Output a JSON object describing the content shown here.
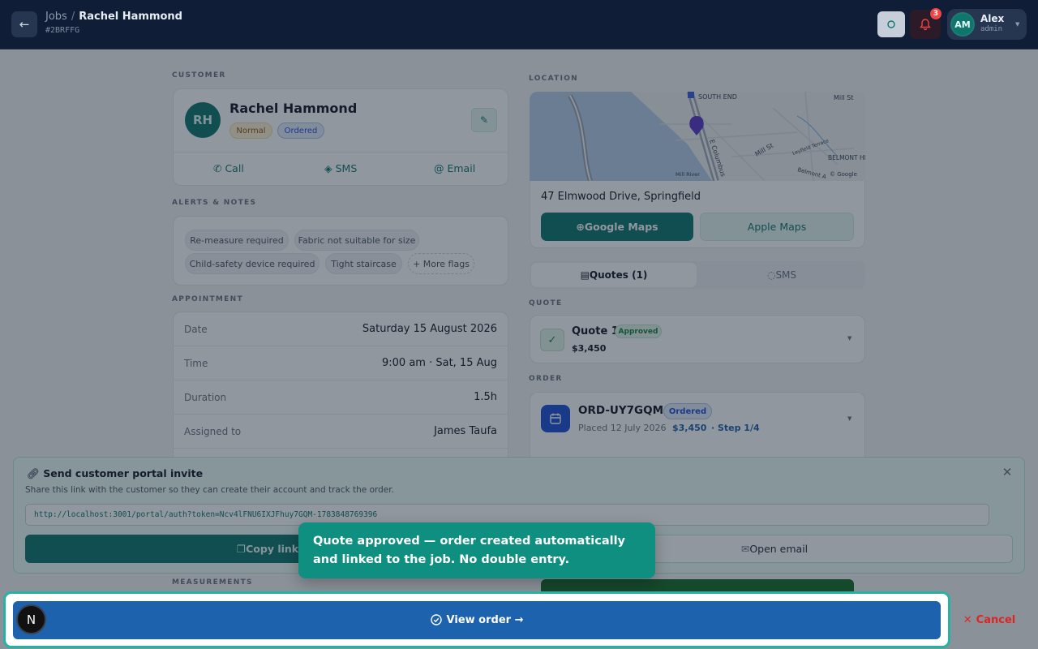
{
  "header": {
    "back_label": "←",
    "breadcrumb_root": "Jobs",
    "breadcrumb_sep": "/",
    "breadcrumb_current": "Rachel Hammond",
    "job_id": "#2BRFFG",
    "notification_count": "3",
    "user": {
      "initials": "AM",
      "name": "Alex",
      "role": "admin"
    }
  },
  "customer": {
    "section": "CUSTOMER",
    "initials": "RH",
    "name": "Rachel Hammond",
    "tags": [
      "Normal",
      "Ordered"
    ],
    "actions": {
      "call": "Call",
      "sms": "SMS",
      "email": "Email"
    }
  },
  "alerts": {
    "section": "ALERTS & NOTES",
    "chips": [
      "Re-measure required",
      "Fabric not suitable for size",
      "Child-safety device required",
      "Tight staircase"
    ],
    "more": "+ More flags"
  },
  "appointment": {
    "section": "APPOINTMENT",
    "rows": [
      {
        "label": "Date",
        "value": "Saturday 15 August 2026"
      },
      {
        "label": "Time",
        "value": "9:00 am · Sat, 15 Aug"
      },
      {
        "label": "Duration",
        "value": "1.5h"
      },
      {
        "label": "Assigned to",
        "value": "James Taufa"
      }
    ]
  },
  "measurements": {
    "section": "MEASUREMENTS"
  },
  "location": {
    "section": "LOCATION",
    "map_labels": {
      "south_end": "SOUTH END",
      "mill_st": "Mill St",
      "mill_st2": "Mill St",
      "columbus": "E Columbus",
      "leyfield": "Leyfield Terrace",
      "belmont_heights": "BELMONT HEIGHTS",
      "belmont_ave": "Belmont A",
      "mill_river": "Mill River",
      "google": "© Google"
    },
    "address": "47 Elmwood Drive, Springfield",
    "google_maps": "Google Maps",
    "apple_maps": "Apple Maps"
  },
  "tabs": {
    "quotes": "Quotes (1)",
    "sms": "SMS"
  },
  "quote": {
    "section": "QUOTE",
    "title": "Quote 1",
    "status": "Approved",
    "amount": "$3,450"
  },
  "order": {
    "section": "ORDER",
    "id": "ORD-UY7GQM",
    "status": "Ordered",
    "placed": "Placed 12 July 2026",
    "amount": "$3,450",
    "step": "· Step 1/4"
  },
  "portal_invite": {
    "title": "Send customer portal invite",
    "description": "Share this link with the customer so they can create their account and track the order.",
    "url": "http://localhost:3001/portal/auth?token=Ncv4lFNU6IXJFhuy7GQM-1783848769396",
    "copy_label": "Copy link",
    "email_label": "Open email"
  },
  "tooltip": {
    "text": "Quote approved — order created automatically and linked to the job. No double entry."
  },
  "footer": {
    "logo": "N",
    "view_order": "View order →",
    "cancel": "Cancel"
  },
  "colors": {
    "teal": "#0f766e",
    "navy": "#0f1e36",
    "blue": "#1d62ad",
    "danger": "#dc2626"
  }
}
